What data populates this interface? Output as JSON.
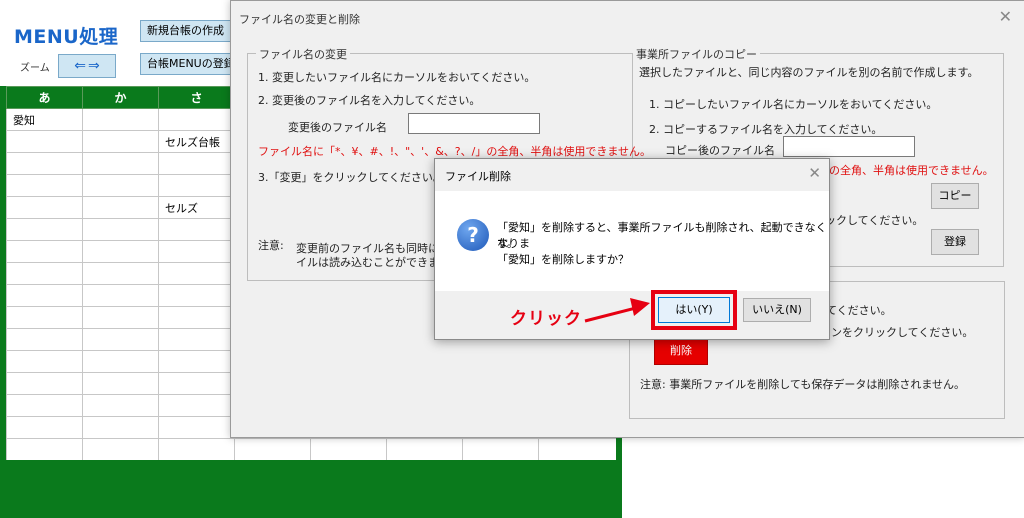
{
  "sheet": {
    "title": "MENU処理",
    "new_ledger_button": "新規台帳の作成",
    "menu_register_button": "台帳MENUの登録",
    "zoom_label": "ズーム",
    "columns": [
      "あ",
      "か",
      "さ"
    ],
    "rows": [
      [
        "愛知",
        "",
        ""
      ],
      [
        "",
        "",
        "セルズ台帳"
      ],
      [
        "",
        "",
        ""
      ],
      [
        "",
        "",
        ""
      ],
      [
        "",
        "",
        "セルズ"
      ]
    ]
  },
  "dialog": {
    "title": "ファイル名の変更と削除",
    "rename": {
      "group_title": "ファイル名の変更",
      "step1": "1. 変更したいファイル名にカーソルをおいてください。",
      "step2": "2. 変更後のファイル名を入力してください。",
      "new_name_label": "変更後のファイル名",
      "warning": "ファイル名に「*、¥、#、!、\"、'、&、?、/」の全角、半角は使用できません。",
      "step3": "3.「変更」をクリックしてください。",
      "note_label": "注意:",
      "note_line1": "変更前のファイル名も同時に変",
      "note_line2": "イルは読み込むことができませ"
    },
    "copy": {
      "group_title": "事業所ファイルのコピー",
      "description": "選択したファイルと、同じ内容のファイルを別の名前で作成します。",
      "step1": "1. コピーしたいファイル名にカーソルをおいてください。",
      "step2": "2. コピーするファイル名を入力してください。",
      "copy_name_label": "コピー後のファイル名",
      "warning_partial": "の全角、半角は使用できません。",
      "copy_button": "コピー",
      "click_text_partial": "ックしてください。",
      "register_button": "登録"
    },
    "delete": {
      "line1_partial": "てください。",
      "line2_partial": "タンをクリックしてください。",
      "delete_button": "削除",
      "note": "注意:  事業所ファイルを削除しても保存データは削除されません。"
    }
  },
  "confirm": {
    "title": "ファイル削除",
    "message_line1": "「愛知」を削除すると、事業所ファイルも削除され、起動できなくなりま",
    "message_line2": "す。",
    "message_line3": "「愛知」を削除しますか？",
    "yes_button": "はい(Y)",
    "no_button": "いいえ(N)"
  },
  "annotation": {
    "click_label": "クリック",
    "color": "#e60012"
  }
}
